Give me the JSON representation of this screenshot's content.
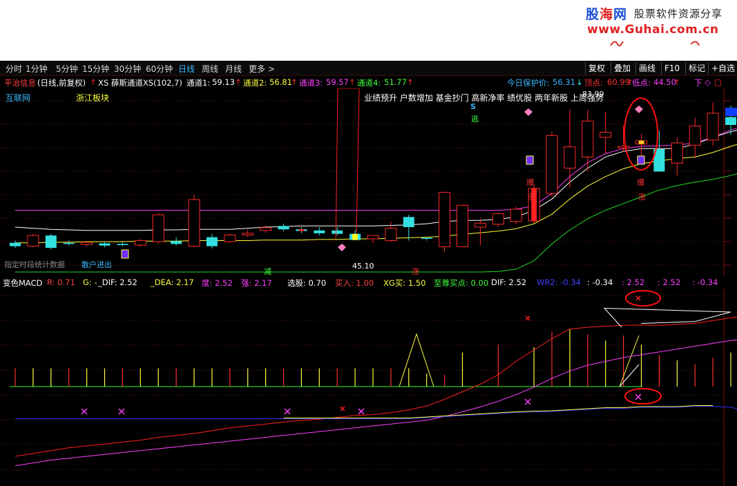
{
  "watermark": {
    "logo_a": "股",
    "logo_b": "海",
    "logo_c": "网",
    "tagline": "股票软件资源分享",
    "url": "www.Guhai.com.cn"
  },
  "toolbar": {
    "periods": [
      "分时",
      "1分钟",
      "5分钟",
      "15分钟",
      "30分钟",
      "60分钟",
      "日线",
      "周线",
      "月线",
      "更多 >"
    ],
    "active_period": "日线",
    "right_buttons": [
      "复权",
      "叠加",
      "画线",
      "F10",
      "标记",
      "+自选"
    ]
  },
  "main_legend": {
    "stock": "平治信息",
    "mode": "(日线,前复权)",
    "indicator": "XS 薛斯通道XS(102,7)",
    "ch1_label": "通道1:",
    "ch1_value": "59.13",
    "ch2_label": "通道2:",
    "ch2_value": "56.81",
    "ch3_label": "通道3:",
    "ch3_value": "59.57",
    "ch4_label": "通道4:",
    "ch4_value": "51.77",
    "protect_label": "今日保护价:",
    "protect_value": "56.31",
    "top_label": "顶点:",
    "top_value": "60.99",
    "low_label": "低点:",
    "low_value": "44.50",
    "down_label": "下"
  },
  "chart_labels": {
    "sector_1": "互联网",
    "sector_2": "浙江板块",
    "concepts": "业绩预升 户数增加 基金抄门 高新净率 绩优股 两年新股 上周强势",
    "price_peak": "83.99",
    "price_low": "45.10",
    "s_mark": "S",
    "flee": "逃",
    "boom": "爆",
    "rise": "涨",
    "reduce": "减",
    "bottom_left": "指定时段统计数据",
    "bottom_left_2": "散户进出"
  },
  "macd_legend": {
    "name": "变色MACD",
    "r": "R: 0.71",
    "g": "G: -",
    "dif": "_DIF: 2.52",
    "dea": "_DEA: 2.17",
    "du": "度: 2.52",
    "qiang": "强: 2.17",
    "xuangu": "选股: 0.70",
    "mairu": "买入: 1.00",
    "xgmai": "XG买: 1.50",
    "zhizun": "至尊买点: 0.00",
    "dif2": "DIF: 2.52",
    "wr2": "WR2: -0.34",
    "v1": ": -0.34",
    "v2": ": 2.52",
    "v3": ": 2.52",
    "v4": ": -0.34"
  },
  "colors": {
    "up": "#ff2a2a",
    "down": "#33e0e0",
    "grid": "#4a0c0c",
    "legend_red": "#ff4040",
    "legend_yellow": "#ffff40",
    "legend_green": "#40ff40",
    "legend_magenta": "#ff40ff",
    "accent_blue": "#39b7ff"
  },
  "chart_data": {
    "type": "candlestick",
    "ohlc": [
      [
        38.2,
        38.6,
        37.3,
        37.6
      ],
      [
        37.6,
        39.8,
        37.4,
        39.5
      ],
      [
        39.5,
        39.8,
        37.0,
        37.3
      ],
      [
        38.2,
        38.6,
        37.7,
        38.0
      ],
      [
        37.9,
        38.5,
        37.5,
        38.3
      ],
      [
        38.1,
        38.4,
        37.4,
        37.7
      ],
      [
        38.0,
        38.3,
        37.6,
        37.8
      ],
      [
        37.8,
        38.9,
        37.5,
        38.6
      ],
      [
        38.4,
        43.5,
        38.0,
        43.2
      ],
      [
        38.5,
        39.2,
        37.7,
        38.0
      ],
      [
        37.6,
        46.8,
        37.4,
        45.9
      ],
      [
        39.2,
        39.8,
        37.2,
        37.6
      ],
      [
        38.4,
        39.8,
        38.2,
        39.6
      ],
      [
        39.6,
        40.5,
        39.2,
        39.9
      ],
      [
        40.4,
        41.3,
        40.0,
        40.9
      ],
      [
        41.2,
        41.6,
        40.3,
        40.6
      ],
      [
        40.6,
        41.0,
        39.9,
        40.3
      ],
      [
        40.4,
        41.0,
        39.5,
        39.9
      ],
      [
        40.4,
        41.0,
        39.5,
        39.8
      ],
      [
        39.8,
        40.5,
        38.8,
        38.7
      ],
      [
        38.9,
        39.5,
        38.2,
        39.5
      ],
      [
        38.6,
        42.0,
        38.4,
        40.8
      ],
      [
        42.8,
        43.2,
        38.6,
        41.0
      ],
      [
        39.1,
        38.9,
        38.6,
        39.0
      ],
      [
        37.5,
        47.2,
        36.6,
        47.2
      ],
      [
        37.5,
        44.9,
        37.8,
        44.9
      ],
      [
        41.0,
        42.5,
        37.8,
        41.7
      ],
      [
        41.5,
        43.6,
        41.0,
        43.4
      ],
      [
        42.0,
        44.6,
        41.5,
        44.2
      ],
      [
        42.1,
        48.7,
        41.7,
        47.9
      ],
      [
        47.0,
        58.0,
        46.5,
        57.3
      ],
      [
        51.5,
        62.0,
        48.0,
        55.3
      ],
      [
        53.5,
        61.9,
        51.0,
        59.9
      ],
      [
        57.0,
        61.6,
        54.1,
        57.9
      ],
      [
        55.1,
        59.1,
        54.4,
        55.4
      ],
      [
        55.8,
        57.6,
        53.4,
        56.4
      ],
      [
        54.9,
        58.2,
        51.1,
        50.9
      ],
      [
        52.4,
        57.0,
        50.2,
        56.0
      ],
      [
        55.6,
        60.5,
        53.3,
        59.0
      ],
      [
        56.5,
        63.2,
        55.5,
        61.3
      ],
      [
        60.6,
        62.7,
        57.5,
        59.2
      ],
      [
        58.6,
        61.0,
        57.6,
        59.7
      ],
      [
        57.4,
        60.2,
        51.6,
        52.3
      ],
      [
        56.1,
        60.9,
        55.5,
        60.5
      ]
    ],
    "xlim_visible": [
      0,
      43
    ],
    "ylim": [
      33,
      64
    ],
    "channels": {
      "white": [
        41.0,
        40.8,
        40.6,
        40.5,
        40.4,
        40.4,
        40.4,
        40.4,
        40.5,
        40.5,
        40.6,
        40.6,
        40.6,
        40.8,
        41.0,
        41.1,
        41.2,
        41.2,
        41.2,
        41.2,
        41.2,
        41.3,
        41.4,
        41.6,
        42.0,
        42.2,
        42.2,
        42.4,
        42.8,
        44.0,
        46.0,
        49.0,
        51.5,
        53.5,
        54.5,
        55.0,
        55.0,
        55.0,
        55.8,
        57.0,
        58.0,
        58.7,
        59.1,
        59.13
      ],
      "yellow": [
        38.2,
        38.2,
        38.3,
        38.3,
        38.4,
        38.4,
        38.4,
        38.5,
        38.5,
        38.5,
        38.6,
        38.6,
        38.6,
        38.6,
        38.7,
        38.7,
        38.7,
        38.8,
        38.8,
        38.9,
        38.9,
        39.0,
        39.1,
        39.2,
        39.4,
        39.7,
        40.0,
        40.3,
        40.7,
        41.6,
        43.3,
        46.0,
        48.3,
        50.0,
        51.4,
        52.3,
        52.8,
        53.2,
        53.5,
        54.3,
        55.4,
        56.3,
        56.6,
        56.81
      ],
      "magenta": [
        44.0,
        44.0,
        44.0,
        44.0,
        44.0,
        44.0,
        44.0,
        44.0,
        44.0,
        44.0,
        44.0,
        44.0,
        44.0,
        44.0,
        44.0,
        44.0,
        44.0,
        44.0,
        44.0,
        44.0,
        44.0,
        44.0,
        44.0,
        44.0,
        44.0,
        44.0,
        44.0,
        44.0,
        44.2,
        44.8,
        47.0,
        50.0,
        52.5,
        54.1,
        55.0,
        55.4,
        55.5,
        55.6,
        56.0,
        57.0,
        58.3,
        59.2,
        59.5,
        59.57
      ],
      "green": [
        33.0,
        33.0,
        33.0,
        33.0,
        33.0,
        33.0,
        33.0,
        33.0,
        33.0,
        33.0,
        33.0,
        33.0,
        33.0,
        33.0,
        33.0,
        33.0,
        33.0,
        33.0,
        33.0,
        33.0,
        33.0,
        33.0,
        33.0,
        33.0,
        33.0,
        33.0,
        33.0,
        33.1,
        33.5,
        35.0,
        38.0,
        40.5,
        42.5,
        44.0,
        45.2,
        46.4,
        47.6,
        48.4,
        49.0,
        49.5,
        50.2,
        51.0,
        51.6,
        51.77
      ]
    },
    "macd": {
      "dif": [
        -4.2,
        -4.05,
        -3.9,
        -3.75,
        -3.65,
        -3.55,
        -3.45,
        -3.35,
        -3.2,
        -3.1,
        -3.0,
        -2.85,
        -2.7,
        -2.6,
        -2.5,
        -2.4,
        -2.3,
        -2.25,
        -2.15,
        -2.05,
        -2.0,
        -1.9,
        -1.75,
        -1.55,
        -1.2,
        -0.8,
        -0.4,
        0.1,
        0.8,
        1.4,
        2.0,
        2.5,
        2.6,
        2.65,
        2.7,
        2.72,
        2.7,
        2.75,
        2.8,
        2.95,
        3.1,
        3.2,
        3.05,
        2.52
      ],
      "dea": [
        -4.7,
        -4.55,
        -4.4,
        -4.3,
        -4.2,
        -4.1,
        -4.0,
        -3.9,
        -3.8,
        -3.7,
        -3.6,
        -3.5,
        -3.4,
        -3.3,
        -3.2,
        -3.1,
        -3.0,
        -2.9,
        -2.8,
        -2.7,
        -2.6,
        -2.5,
        -2.4,
        -2.3,
        -2.1,
        -1.85,
        -1.6,
        -1.3,
        -0.95,
        -0.55,
        -0.1,
        0.3,
        0.6,
        0.8,
        1.0,
        1.15,
        1.3,
        1.45,
        1.6,
        1.75,
        1.9,
        2.0,
        2.1,
        2.17
      ],
      "bars": [
        0.7,
        0.7,
        0.7,
        0.7,
        0.7,
        0.7,
        0.7,
        0.7,
        0.7,
        0.7,
        0.7,
        0.7,
        0.7,
        0.7,
        0.7,
        0.7,
        0.7,
        0.7,
        0.7,
        0.7,
        0.7,
        0.7,
        0.7,
        0.5,
        0.45,
        1.3,
        0.0,
        1.6,
        0.0,
        1.5,
        2.1,
        2.2,
        2.0,
        1.75,
        1.95,
        1.6,
        1.2,
        1.0,
        0.85,
        1.1,
        1.3,
        1.6,
        0.0,
        0.7
      ],
      "blue_line": [
        -0.35,
        -0.35,
        -0.35,
        -0.35,
        -0.35,
        -0.35,
        -0.35,
        -0.35,
        -0.35,
        -0.35,
        -0.35,
        -0.35,
        -0.35,
        -0.35,
        -0.35,
        -0.35,
        -0.35,
        -0.35,
        -0.35,
        -0.35,
        -0.35,
        -0.35,
        -0.35,
        -0.3,
        -0.25,
        -0.2,
        -0.15,
        -0.1,
        -0.05,
        -0.02,
        0.0,
        0.05,
        0.1,
        0.15,
        0.15,
        0.2,
        0.2,
        0.2,
        0.25,
        0.25,
        0.2,
        0.0,
        -0.2,
        -0.34
      ],
      "ylim": [
        -5.4,
        4.2
      ]
    }
  }
}
